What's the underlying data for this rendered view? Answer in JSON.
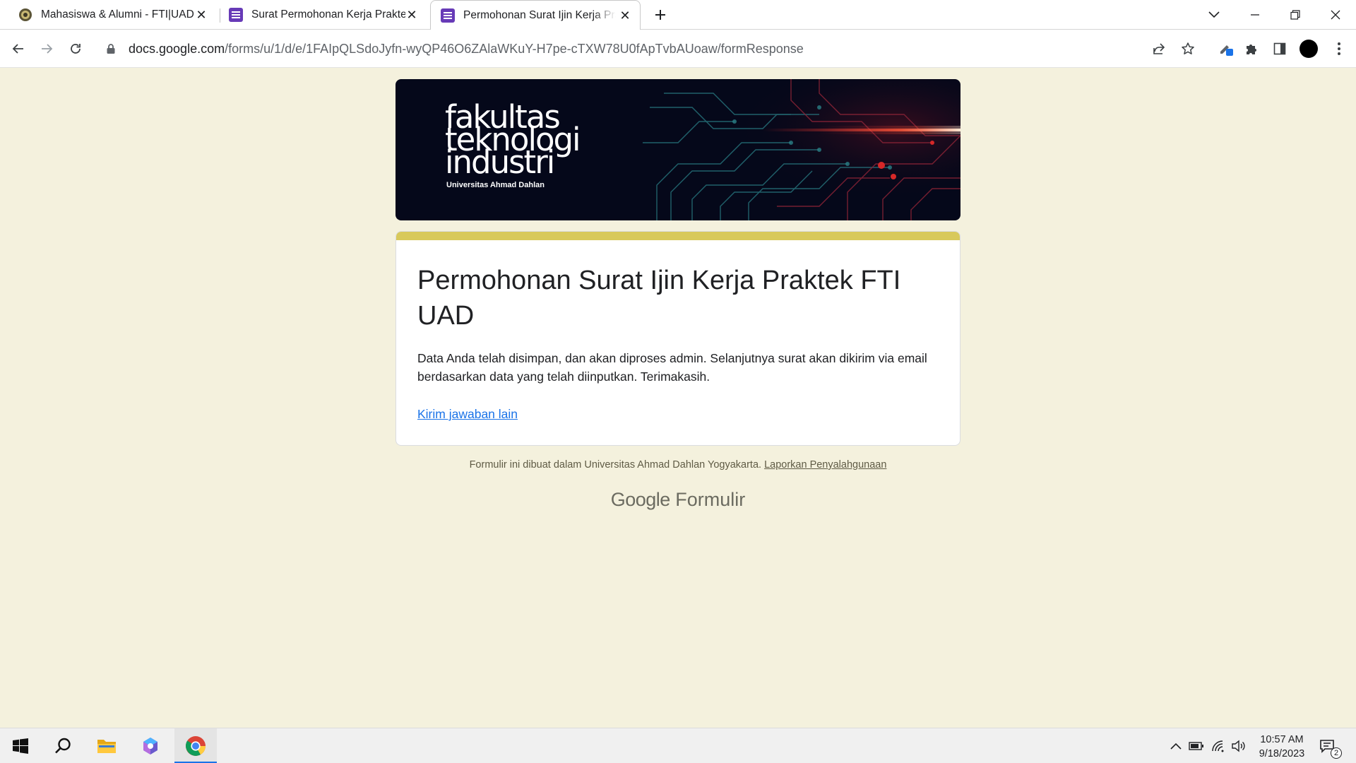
{
  "browser": {
    "tabs": [
      {
        "title": "Mahasiswa & Alumni - FTI|UAD",
        "favicon": "uad-seal-icon",
        "active": false
      },
      {
        "title": "Surat Permohonan Kerja Praktek",
        "favicon": "google-forms-icon",
        "active": false
      },
      {
        "title": "Permohonan Surat Ijin Kerja Praktek FTI UAD",
        "favicon": "google-forms-icon",
        "active": true
      }
    ],
    "url_host": "docs.google.com",
    "url_path": "/forms/u/1/d/e/1FAIpQLSdoJyfn-wyQP46O6ZAlaWKuY-H7pe-cTXW78U0fApTvbAUoaw/formResponse"
  },
  "banner": {
    "logo_lines": [
      "fakultas",
      "teknologi",
      "industri"
    ],
    "logo_subtitle": "Universitas Ahmad Dahlan"
  },
  "form": {
    "title": "Permohonan Surat Ijin Kerja Praktek FTI UAD",
    "message": "Data Anda telah disimpan, dan akan diproses admin. Selanjutnya surat akan dikirim via email berdasarkan data yang telah diinputkan. Terimakasih.",
    "link_text": "Kirim jawaban lain",
    "accent_color": "#d8c95b"
  },
  "footer": {
    "note": "Formulir ini dibuat dalam Universitas Ahmad Dahlan Yogyakarta.",
    "report_link": "Laporkan Penyalahgunaan",
    "brand_google": "Google",
    "brand_product": "Formulir"
  },
  "taskbar": {
    "time": "10:57 AM",
    "date": "9/18/2023",
    "notification_count": "2"
  }
}
